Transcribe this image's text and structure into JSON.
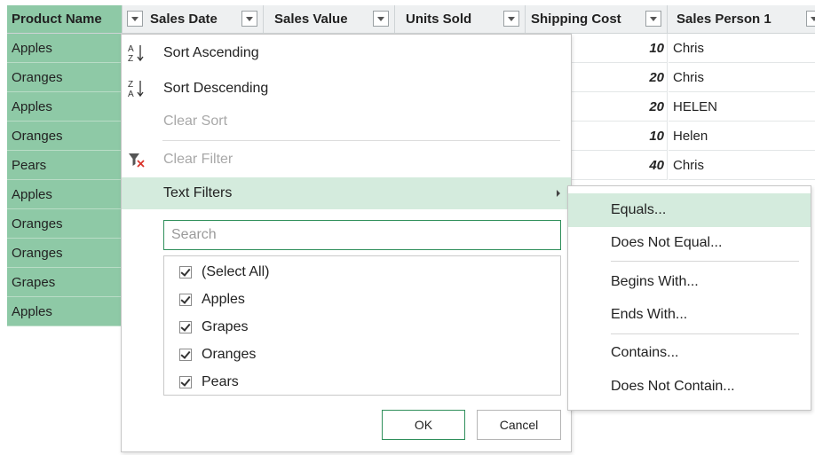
{
  "grid": {
    "columns": [
      {
        "label": "Product Name"
      },
      {
        "label": "Sales Date"
      },
      {
        "label": "Sales Value"
      },
      {
        "label": "Units Sold"
      },
      {
        "label": "Shipping Cost"
      },
      {
        "label": "Sales Person 1"
      }
    ],
    "product_names": [
      "Apples",
      "Oranges",
      "Apples",
      "Oranges",
      "Pears",
      "Apples",
      "Oranges",
      "Oranges",
      "Grapes",
      "Apples"
    ],
    "shipping_cost_visible": [
      "10",
      "20",
      "20",
      "10",
      "40"
    ],
    "sales_person_visible": [
      "Chris",
      "Chris",
      "HELEN",
      "Helen",
      "Chris"
    ]
  },
  "menu": {
    "sort_ascending": "Sort Ascending",
    "sort_descending": "Sort Descending",
    "clear_sort": "Clear Sort",
    "clear_filter": "Clear Filter",
    "text_filters": "Text Filters",
    "search_placeholder": "Search",
    "checklist": [
      {
        "label": "(Select All)",
        "checked": true
      },
      {
        "label": "Apples",
        "checked": true
      },
      {
        "label": "Grapes",
        "checked": true
      },
      {
        "label": "Oranges",
        "checked": true
      },
      {
        "label": "Pears",
        "checked": true
      }
    ],
    "ok_label": "OK",
    "cancel_label": "Cancel"
  },
  "submenu": {
    "items": [
      "Equals...",
      "Does Not Equal...",
      "Begins With...",
      "Ends With...",
      "Contains...",
      "Does Not Contain..."
    ]
  },
  "colors": {
    "highlight": "#d4ebdd",
    "selected_column": "#8ec9a6",
    "accent": "#2f8f5b"
  }
}
